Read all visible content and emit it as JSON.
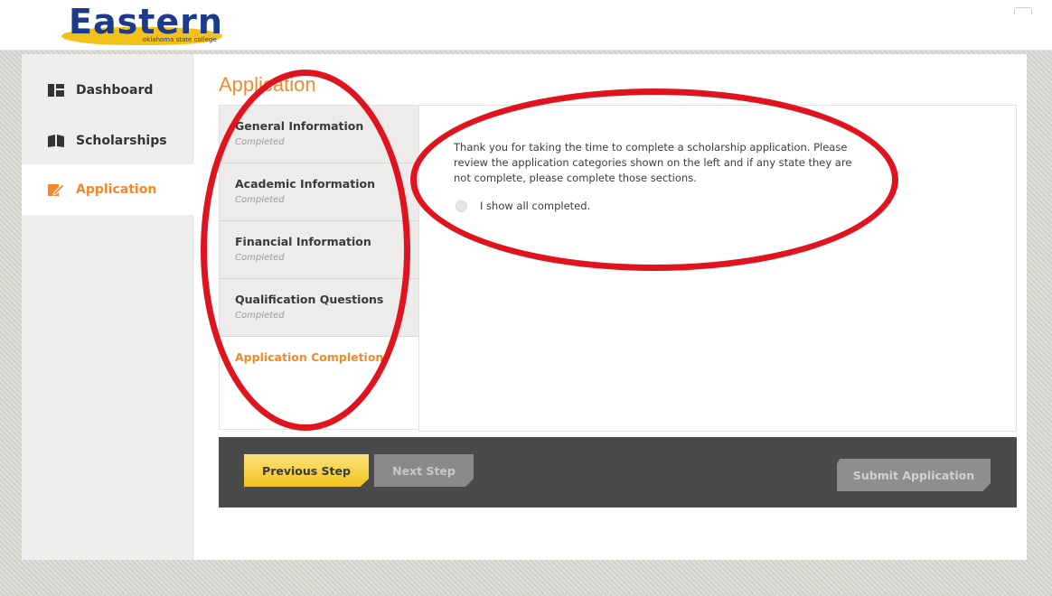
{
  "header": {
    "logo_text": "Eastern",
    "logo_subtext": "oklahoma state college"
  },
  "sidebar": {
    "items": [
      {
        "label": "Dashboard",
        "icon": "dashboard-icon",
        "active": false
      },
      {
        "label": "Scholarships",
        "icon": "book-icon",
        "active": false
      },
      {
        "label": "Application",
        "icon": "edit-icon",
        "active": true
      }
    ]
  },
  "page": {
    "title": "Application"
  },
  "steps": [
    {
      "title": "General Information",
      "status": "Completed"
    },
    {
      "title": "Academic Information",
      "status": "Completed"
    },
    {
      "title": "Financial Information",
      "status": "Completed"
    },
    {
      "title": "Qualification Questions",
      "status": "Completed"
    },
    {
      "title": "Application Completion",
      "status": ""
    }
  ],
  "completion": {
    "intro_text": "Thank you for taking the time to complete a scholarship application. Please review the application categories shown on the left and if any state they are not complete, please complete those sections.",
    "confirm_label": "I show all completed."
  },
  "footer": {
    "previous_label": "Previous Step",
    "next_label": "Next Step",
    "submit_label": "Submit Application"
  },
  "colors": {
    "accent": "#f08a2c",
    "annotation": "#e0141e",
    "button_primary": "#f5cd32",
    "footer_bar": "#4a4a4a"
  }
}
